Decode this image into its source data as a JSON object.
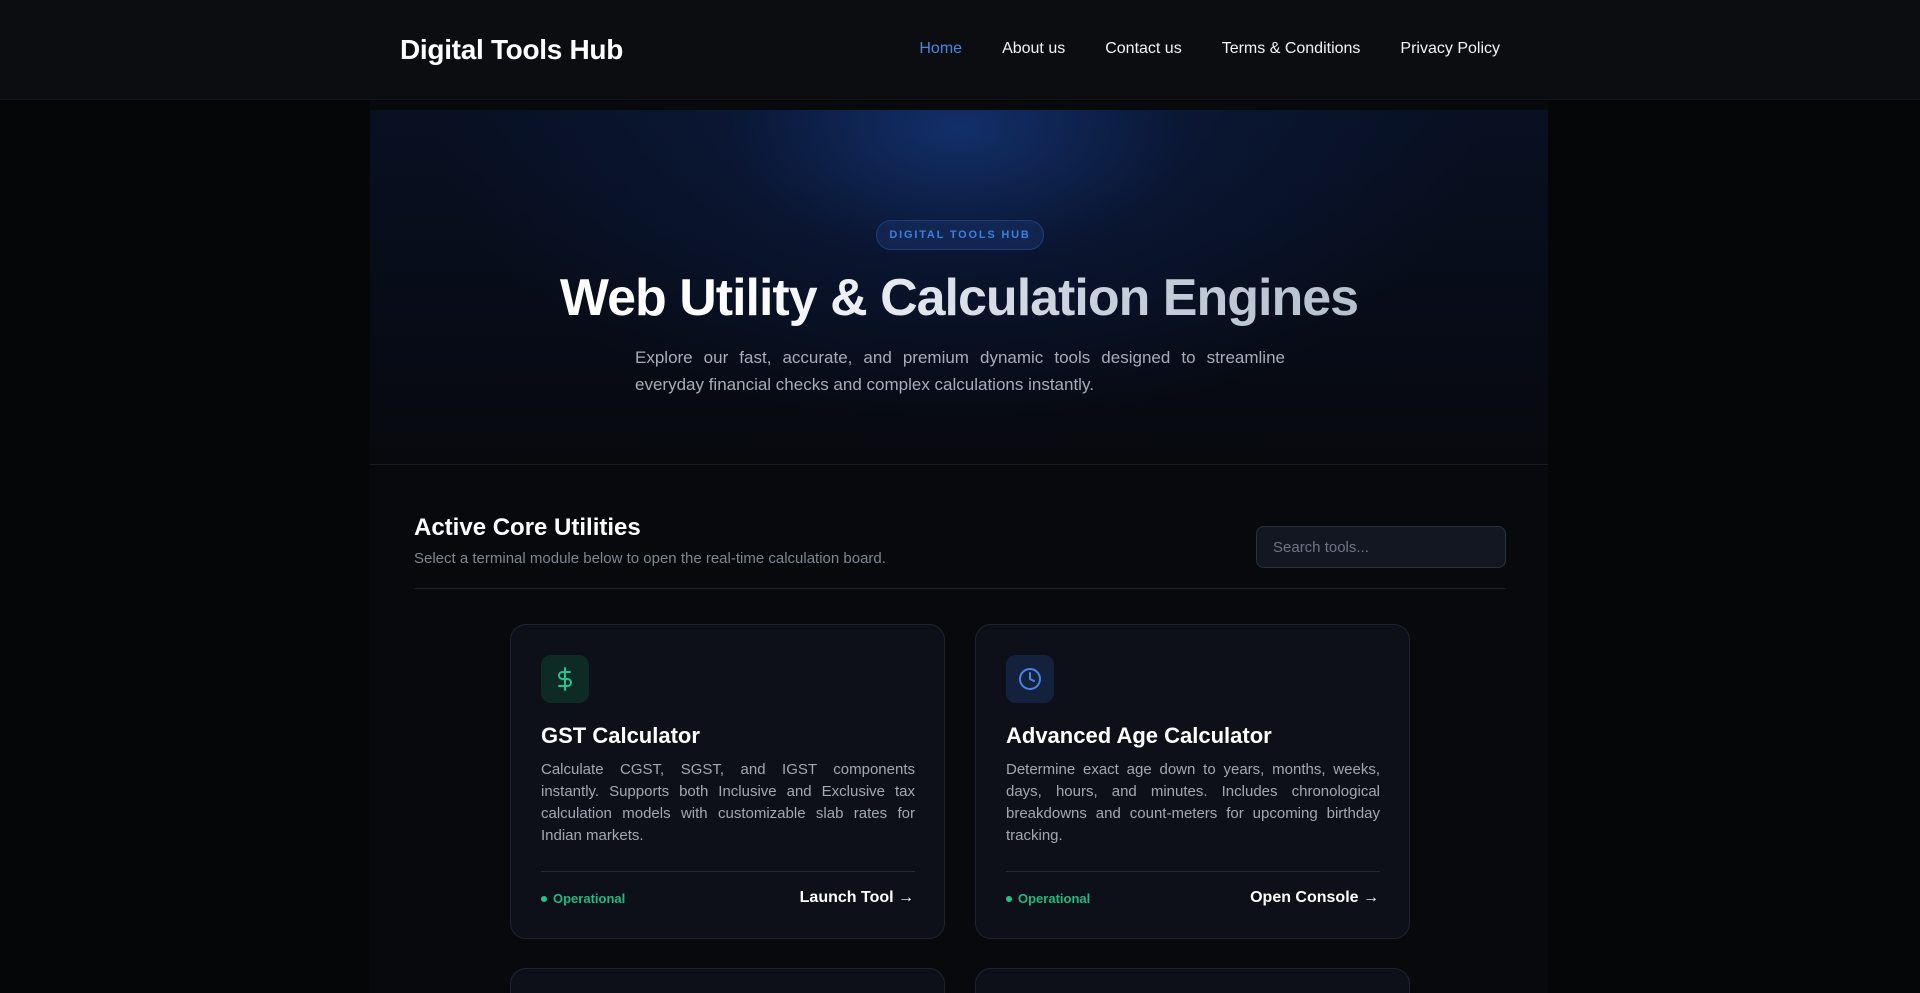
{
  "header": {
    "brand": "Digital Tools Hub",
    "nav": [
      {
        "label": "Home",
        "active": true
      },
      {
        "label": "About us",
        "active": false
      },
      {
        "label": "Contact us",
        "active": false
      },
      {
        "label": "Terms & Conditions",
        "active": false
      },
      {
        "label": "Privacy Policy",
        "active": false
      }
    ]
  },
  "hero": {
    "badge": "DIGITAL TOOLS HUB",
    "title": "Web Utility & Calculation Engines",
    "subtitle": "Explore our fast, accurate, and premium dynamic tools designed to streamline everyday financial checks and complex calculations instantly."
  },
  "section": {
    "title": "Active Core Utilities",
    "subtitle": "Select a terminal module below to open the real-time calculation board.",
    "search_placeholder": "Search tools..."
  },
  "cards": [
    {
      "icon": "dollar-icon",
      "title": "GST Calculator",
      "description": "Calculate CGST, SGST, and IGST components instantly. Supports both Inclusive and Exclusive tax calculation models with customizable slab rates for Indian markets.",
      "status": "Operational",
      "action": "Launch Tool →"
    },
    {
      "icon": "clock-icon",
      "title": "Advanced Age Calculator",
      "description": "Determine exact age down to years, months, weeks, days, hours, and minutes. Includes chronological breakdowns and count-meters for upcoming birthday tracking.",
      "status": "Operational",
      "action": "Open Console →"
    }
  ],
  "colors": {
    "accent": "#4a84e3",
    "status_green": "#21b980",
    "background": "#050607"
  }
}
